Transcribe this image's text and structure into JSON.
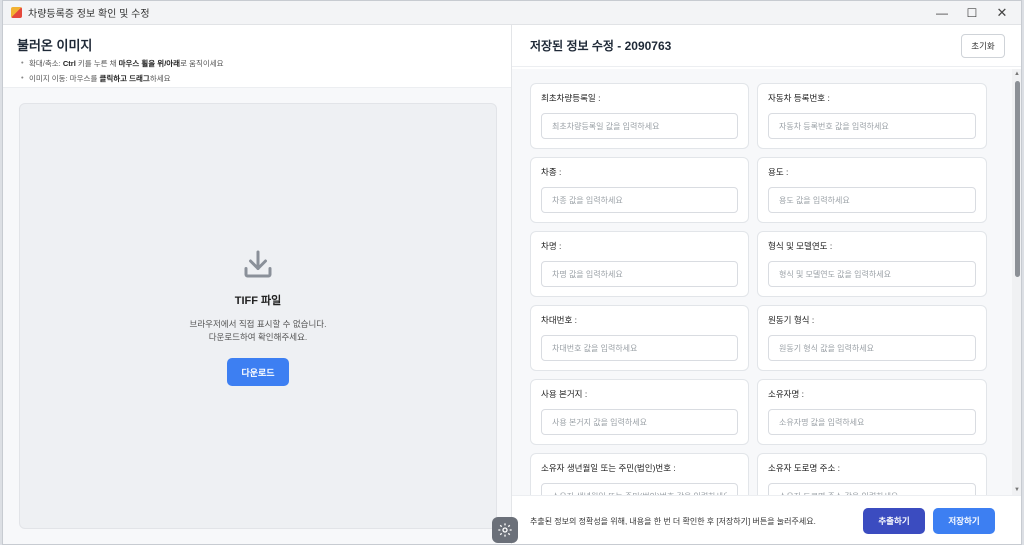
{
  "window": {
    "title": "차량등록증 정보 확인 및 수정",
    "minimize_glyph": "—",
    "maximize_glyph": "☐",
    "close_glyph": "✕"
  },
  "left_panel": {
    "title": "불러온 이미지",
    "hint1_prefix": "확대/축소: ",
    "hint1_key": "Ctrl",
    "hint1_mid": " 키를 누른 채 ",
    "hint1_action": "마우스 휠을 위/아래",
    "hint1_suffix": "로 움직이세요",
    "hint2_prefix": "이미지 이동: 마우스를 ",
    "hint2_action": "클릭하고 드래그",
    "hint2_suffix": "하세요",
    "file_type": "TIFF 파일",
    "message_line1": "브라우저에서 직접 표시할 수 없습니다.",
    "message_line2": "다운로드하여 확인해주세요.",
    "download_label": "다운로드",
    "icon": "download-icon"
  },
  "right_panel": {
    "title": "저장된 정보 수정 - 2090763",
    "reset_label": "초기화",
    "fields": [
      {
        "label": "최초차량등록일 :",
        "placeholder": "최초차량등록일 값을 입력하세요"
      },
      {
        "label": "자동차 등록번호 :",
        "placeholder": "자동차 등록번호 값을 입력하세요"
      },
      {
        "label": "차종 :",
        "placeholder": "차종 값을 입력하세요"
      },
      {
        "label": "용도 :",
        "placeholder": "용도 값을 입력하세요"
      },
      {
        "label": "차명 :",
        "placeholder": "차명 값을 입력하세요"
      },
      {
        "label": "형식 및 모델연도 :",
        "placeholder": "형식 및 모델연도 값을 입력하세요"
      },
      {
        "label": "차대번호 :",
        "placeholder": "차대번호 값을 입력하세요"
      },
      {
        "label": "원동기 형식 :",
        "placeholder": "원동기 형식 값을 입력하세요"
      },
      {
        "label": "사용 본거지 :",
        "placeholder": "사용 본거지 값을 입력하세요"
      },
      {
        "label": "소유자명 :",
        "placeholder": "소유자명 값을 입력하세요"
      },
      {
        "label": "소유자 생년월일 또는 주민(법인)번호 :",
        "placeholder": "소유자 생년월일 또는 주민(법인)번호 값을 입력하세요"
      },
      {
        "label": "소유자 도로명 주소 :",
        "placeholder": "소유자 도로명 주소 값을 입력하세요"
      }
    ],
    "footer_text": "추출된 정보의 정확성을 위해, 내용을 한 번 더 확인한 후 [저장하기] 버튼을 눌러주세요.",
    "extract_label": "추출하기",
    "save_label": "저장하기"
  },
  "colors": {
    "primary": "#3d7ff2",
    "extract": "#3b4cc0"
  }
}
